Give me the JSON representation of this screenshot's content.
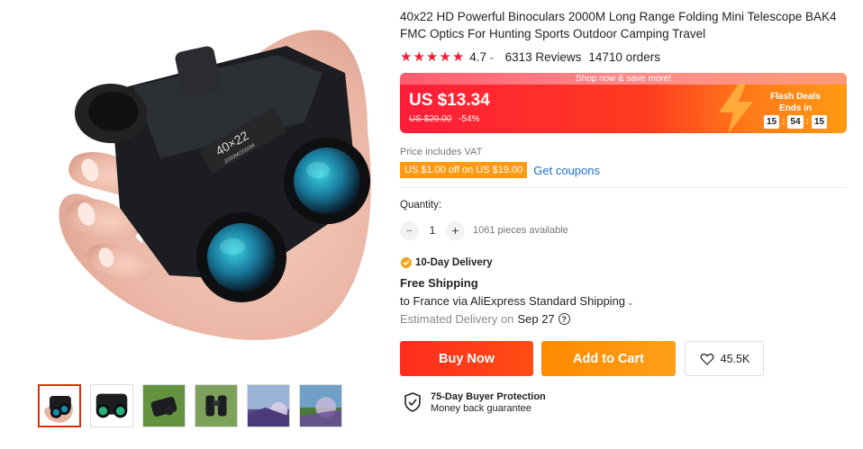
{
  "product": {
    "title": "40x22 HD Powerful Binoculars 2000M Long Range Folding Mini Telescope BAK4 FMC Optics For Hunting Sports Outdoor Camping Travel",
    "rating": "4.7",
    "reviews": "6313 Reviews",
    "orders": "14710 orders",
    "main_image_icon": "binoculars-in-hand-image",
    "binocular_label_top": "40×22",
    "binocular_label_bottom": "2000M/2000M"
  },
  "gallery": {
    "thumbnails": [
      {
        "icon": "binoculars-hand-thumb"
      },
      {
        "icon": "binoculars-black-thumb"
      },
      {
        "icon": "binoculars-grass-thumb"
      },
      {
        "icon": "binoculars-field-thumb"
      },
      {
        "icon": "scenery-video-thumb"
      },
      {
        "icon": "scenery-view-thumb"
      }
    ]
  },
  "price_banner": {
    "top_text": "Shop now & save more!",
    "current_price": "US $13.34",
    "original_price": "US $29.00",
    "discount": "-54%",
    "flash_title": "Flash Deals",
    "ends_in": "Ends in",
    "timer": {
      "hours": "15",
      "minutes": "54",
      "seconds": "15"
    }
  },
  "vat_note": "Price includes VAT",
  "coupon": {
    "badge": "US $1.00 off on US $19.00",
    "link": "Get coupons"
  },
  "quantity": {
    "label": "Quantity:",
    "value": "1",
    "minus": "−",
    "plus": "+",
    "available": "1061 pieces available"
  },
  "delivery": {
    "badge": "10-Day Delivery",
    "free_shipping": "Free Shipping",
    "ship_to": "to France via AliExpress Standard Shipping",
    "estimated_label": "Estimated Delivery on",
    "estimated_date": "Sep 27",
    "help": "?"
  },
  "actions": {
    "buy_now": "Buy Now",
    "add_to_cart": "Add to Cart",
    "wishlist_count": "45.5K"
  },
  "protection": {
    "title": "75-Day Buyer Protection",
    "subtitle": "Money back guarantee"
  },
  "colors": {
    "brand_red": "#ff2b1f",
    "cart_orange": "#ff9a12",
    "star": "#f31c34",
    "coupon_link": "#1a6fc9"
  }
}
